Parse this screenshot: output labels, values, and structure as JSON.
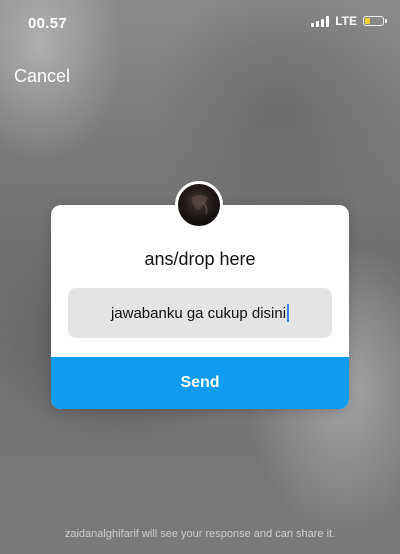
{
  "status_bar": {
    "time": "00.57",
    "network": "LTE",
    "battery_level": 0.3,
    "colors": {
      "battery": "#f5d33b",
      "text": "#ffffff"
    }
  },
  "header": {
    "cancel_label": "Cancel"
  },
  "card": {
    "question": "ans/drop here",
    "answer_value": "jawabanku ga cukup disini",
    "send_label": "Send",
    "colors": {
      "send": "#0f9bf0",
      "answer_box": "#e4e4e4",
      "caret": "#3d7ff0"
    }
  },
  "footer": {
    "note": "zaidanalghifarif will see your response and can share it."
  },
  "icons": [
    "signal-icon",
    "battery-icon",
    "avatar"
  ]
}
